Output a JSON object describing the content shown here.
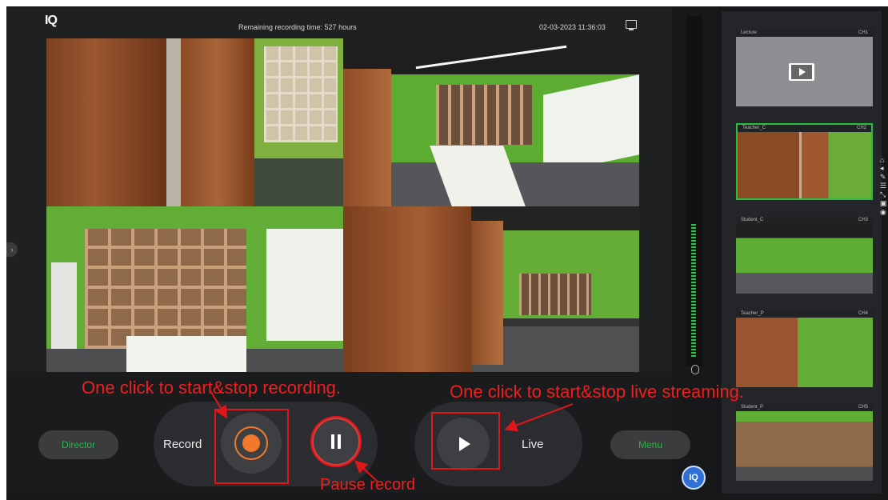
{
  "topbar": {
    "logo": "IQ",
    "remaining_time": "Remaining recording time: 527 hours",
    "datetime": "02-03-2023 11:36:03"
  },
  "controls": {
    "director_label": "Director",
    "record_label": "Record",
    "live_label": "Live",
    "menu_label": "Menu",
    "badge_label": "IQ"
  },
  "annotations": {
    "record": "One click to start&stop recording.",
    "live": "One click to start&stop live streaming.",
    "pause": "Pause record"
  },
  "channels": [
    {
      "name": "Lecture",
      "id": "CH1"
    },
    {
      "name": "Teacher_C",
      "id": "CH2"
    },
    {
      "name": "Student_C",
      "id": "CH3"
    },
    {
      "name": "Teacher_P",
      "id": "CH4"
    },
    {
      "name": "Student_P",
      "id": "CH5"
    }
  ],
  "colors": {
    "accent_green": "#2db34a",
    "record_orange": "#f07a2a",
    "annotation_red": "#f21d1d",
    "selected_border": "#2ebd3e"
  }
}
